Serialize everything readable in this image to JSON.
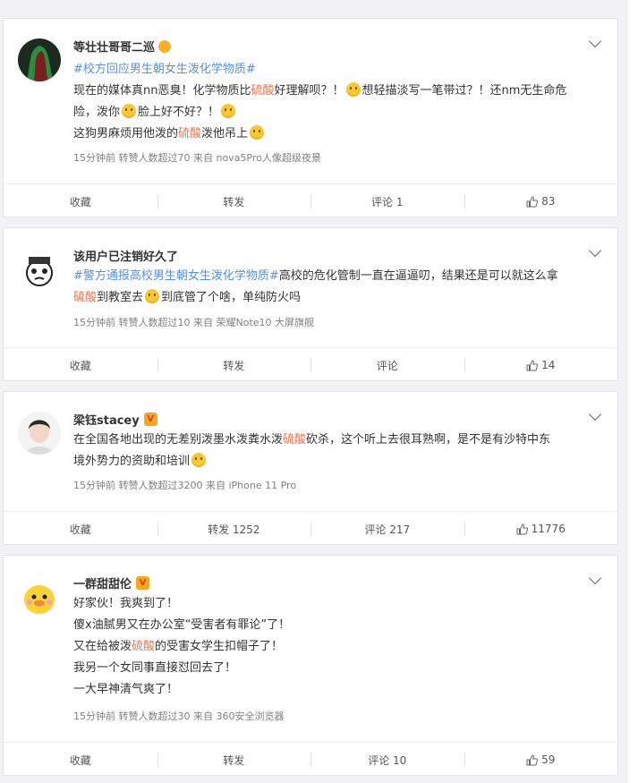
{
  "posts": [
    {
      "user": "等壮壮哥哥二巡",
      "badge": "crown",
      "lines": [
        [
          {
            "t": "#校方回应男生朝女生泼化学物质#",
            "k": "tag"
          }
        ],
        [
          {
            "t": "现在的媒体真nn恶臭！化学物质比"
          },
          {
            "t": "硫酸",
            "k": "hl"
          },
          {
            "t": "好理解呗？！"
          },
          {
            "e": 1
          },
          {
            "t": "想轻描淡写一笔带过？！还nm无生命危"
          }
        ],
        [
          {
            "t": "险，泼你"
          },
          {
            "e": 1
          },
          {
            "t": "脸上好不好？！"
          },
          {
            "e": 1
          }
        ],
        [
          {
            "t": "这狗男麻烦用他泼的"
          },
          {
            "t": "硫酸",
            "k": "hl"
          },
          {
            "t": "泼他吊上"
          },
          {
            "e": 1
          }
        ]
      ],
      "meta": "15分钟前 转赞人数超过70 来自 nova5Pro人像超级夜景",
      "collect": "收藏",
      "forward": "转发",
      "comment": "评论 1",
      "likes": "83"
    },
    {
      "user": "该用户已注销好久了",
      "badge": "",
      "lines": [
        [
          {
            "t": "#警方通报高校男生朝女生泼化学物质#",
            "k": "tag"
          },
          {
            "t": "高校的危化管制一直在逼逼叨，结果还是可以就这么拿"
          }
        ],
        [
          {
            "t": "硫酸",
            "k": "hl"
          },
          {
            "t": "到教室去"
          },
          {
            "e": 1
          },
          {
            "t": "到底管了个啥，单纯防火吗"
          }
        ]
      ],
      "meta": "15分钟前 转赞人数超过10 来自 荣耀Note10 大屏旗舰",
      "collect": "收藏",
      "forward": "转发",
      "comment": "评论",
      "likes": "14"
    },
    {
      "user": "梁钰stacey",
      "badge": "v",
      "lines": [
        [
          {
            "t": "在全国各地出现的无差别泼墨水泼粪水泼"
          },
          {
            "t": "硫酸",
            "k": "hl"
          },
          {
            "t": "砍杀，这个听上去很耳熟啊，是不是有沙特中东"
          }
        ],
        [
          {
            "t": "境外势力的资助和培训"
          },
          {
            "e": 1
          }
        ]
      ],
      "meta": "15分钟前 转赞人数超过3200 来自 iPhone 11 Pro",
      "collect": "收藏",
      "forward": "转发 1252",
      "comment": "评论 217",
      "likes": "11776"
    },
    {
      "user": "一群甜甜伦",
      "badge": "v",
      "lines": [
        [
          {
            "t": "好家伙！我爽到了！"
          }
        ],
        [
          {
            "t": "傻x油腻男又在办公室“受害者有罪论”了！"
          }
        ],
        [
          {
            "t": "又在给被泼"
          },
          {
            "t": "硫酸",
            "k": "hl"
          },
          {
            "t": "的受害女学生扣帽子了！"
          }
        ],
        [
          {
            "t": "我另一个女同事直接怼回去了！"
          }
        ],
        [
          {
            "t": "一大早神清气爽了！"
          }
        ]
      ],
      "meta": "15分钟前 转赞人数超过30 来自 360安全浏览器",
      "collect": "收藏",
      "forward": "转发",
      "comment": "评论 10",
      "likes": "59"
    }
  ],
  "colors": {
    "highlight": "#eb7350",
    "topic": "#5a8fd8",
    "meta": "#808080",
    "vip": "#f5a623"
  },
  "icons": [
    "chevron-down-icon",
    "thumbs-up-icon",
    "emoji-icon",
    "verified-v-icon",
    "crown-icon"
  ]
}
